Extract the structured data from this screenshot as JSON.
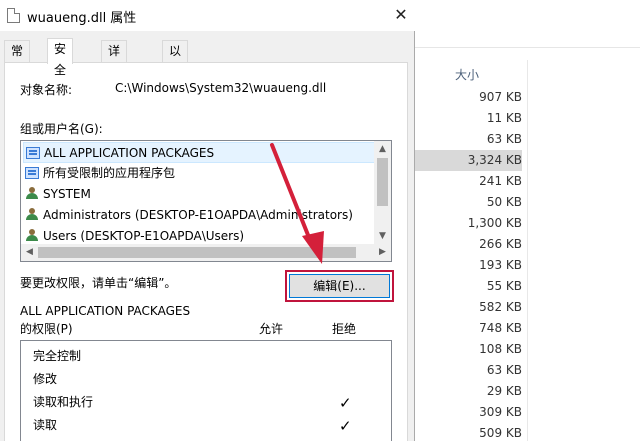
{
  "dialog": {
    "title": "wuaueng.dll 属性",
    "close_label": "✕",
    "tabs": [
      {
        "label": "常规"
      },
      {
        "label": "安全"
      },
      {
        "label": "详细信息"
      },
      {
        "label": "以前的版本"
      }
    ],
    "object_name_label": "对象名称:",
    "object_name_value": "C:\\Windows\\System32\\wuaueng.dll",
    "group_label": "组或用户名(G):",
    "groups": [
      {
        "name": "ALL APPLICATION PACKAGES",
        "icon": "package-icon"
      },
      {
        "name": "所有受限制的应用程序包",
        "icon": "package-icon"
      },
      {
        "name": "SYSTEM",
        "icon": "users-icon"
      },
      {
        "name": "Administrators (DESKTOP-E1OAPDA\\Administrators)",
        "icon": "users-icon"
      },
      {
        "name": "Users (DESKTOP-E1OAPDA\\Users)",
        "icon": "users-icon"
      }
    ],
    "change_hint": "要更改权限，请单击“编辑”。",
    "edit_button": "编辑(E)...",
    "perm_for_line1": "ALL APPLICATION PACKAGES",
    "perm_for_line2": "的权限(P)",
    "allow_header": "允许",
    "deny_header": "拒绝",
    "permissions": [
      {
        "name": "完全控制",
        "allow": ""
      },
      {
        "name": "修改",
        "allow": ""
      },
      {
        "name": "读取和执行",
        "allow": "✓"
      },
      {
        "name": "读取",
        "allow": "✓"
      }
    ],
    "accent_color": "#0078d7",
    "highlight_color": "#c0143c"
  },
  "explorer": {
    "size_header": "大小",
    "sizes": [
      "907 KB",
      "11 KB",
      "63 KB",
      "3,324 KB",
      "241 KB",
      "50 KB",
      "1,300 KB",
      "266 KB",
      "193 KB",
      "55 KB",
      "582 KB",
      "748 KB",
      "108 KB",
      "63 KB",
      "29 KB",
      "309 KB",
      "509 KB"
    ]
  }
}
